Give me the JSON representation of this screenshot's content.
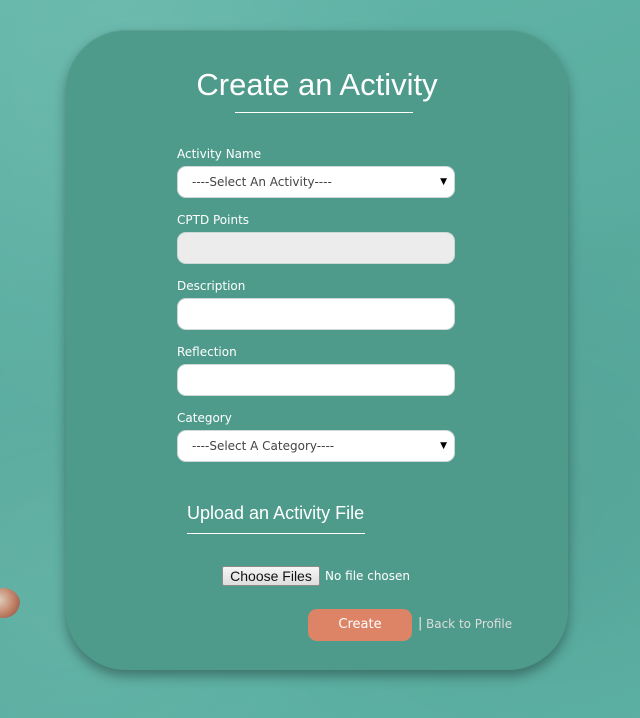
{
  "form": {
    "title": "Create an Activity",
    "fields": [
      {
        "label": "Activity Name",
        "type": "select",
        "value": "----Select An Activity----"
      },
      {
        "label": "CPTD Points",
        "type": "text",
        "value": ""
      },
      {
        "label": "Description",
        "type": "text",
        "value": ""
      },
      {
        "label": "Reflection",
        "type": "text",
        "value": ""
      },
      {
        "label": "Category",
        "type": "select",
        "value": "----Select A Category----"
      }
    ],
    "caret": "▼"
  },
  "upload": {
    "heading": "Upload an Activity File",
    "button_label": "Choose Files",
    "status": "No file chosen"
  },
  "actions": {
    "create_label": "Create",
    "separator": "|",
    "back_label": "Back to Profile"
  },
  "colors": {
    "card": "#4e9b8b",
    "create_button": "#dd8466"
  }
}
